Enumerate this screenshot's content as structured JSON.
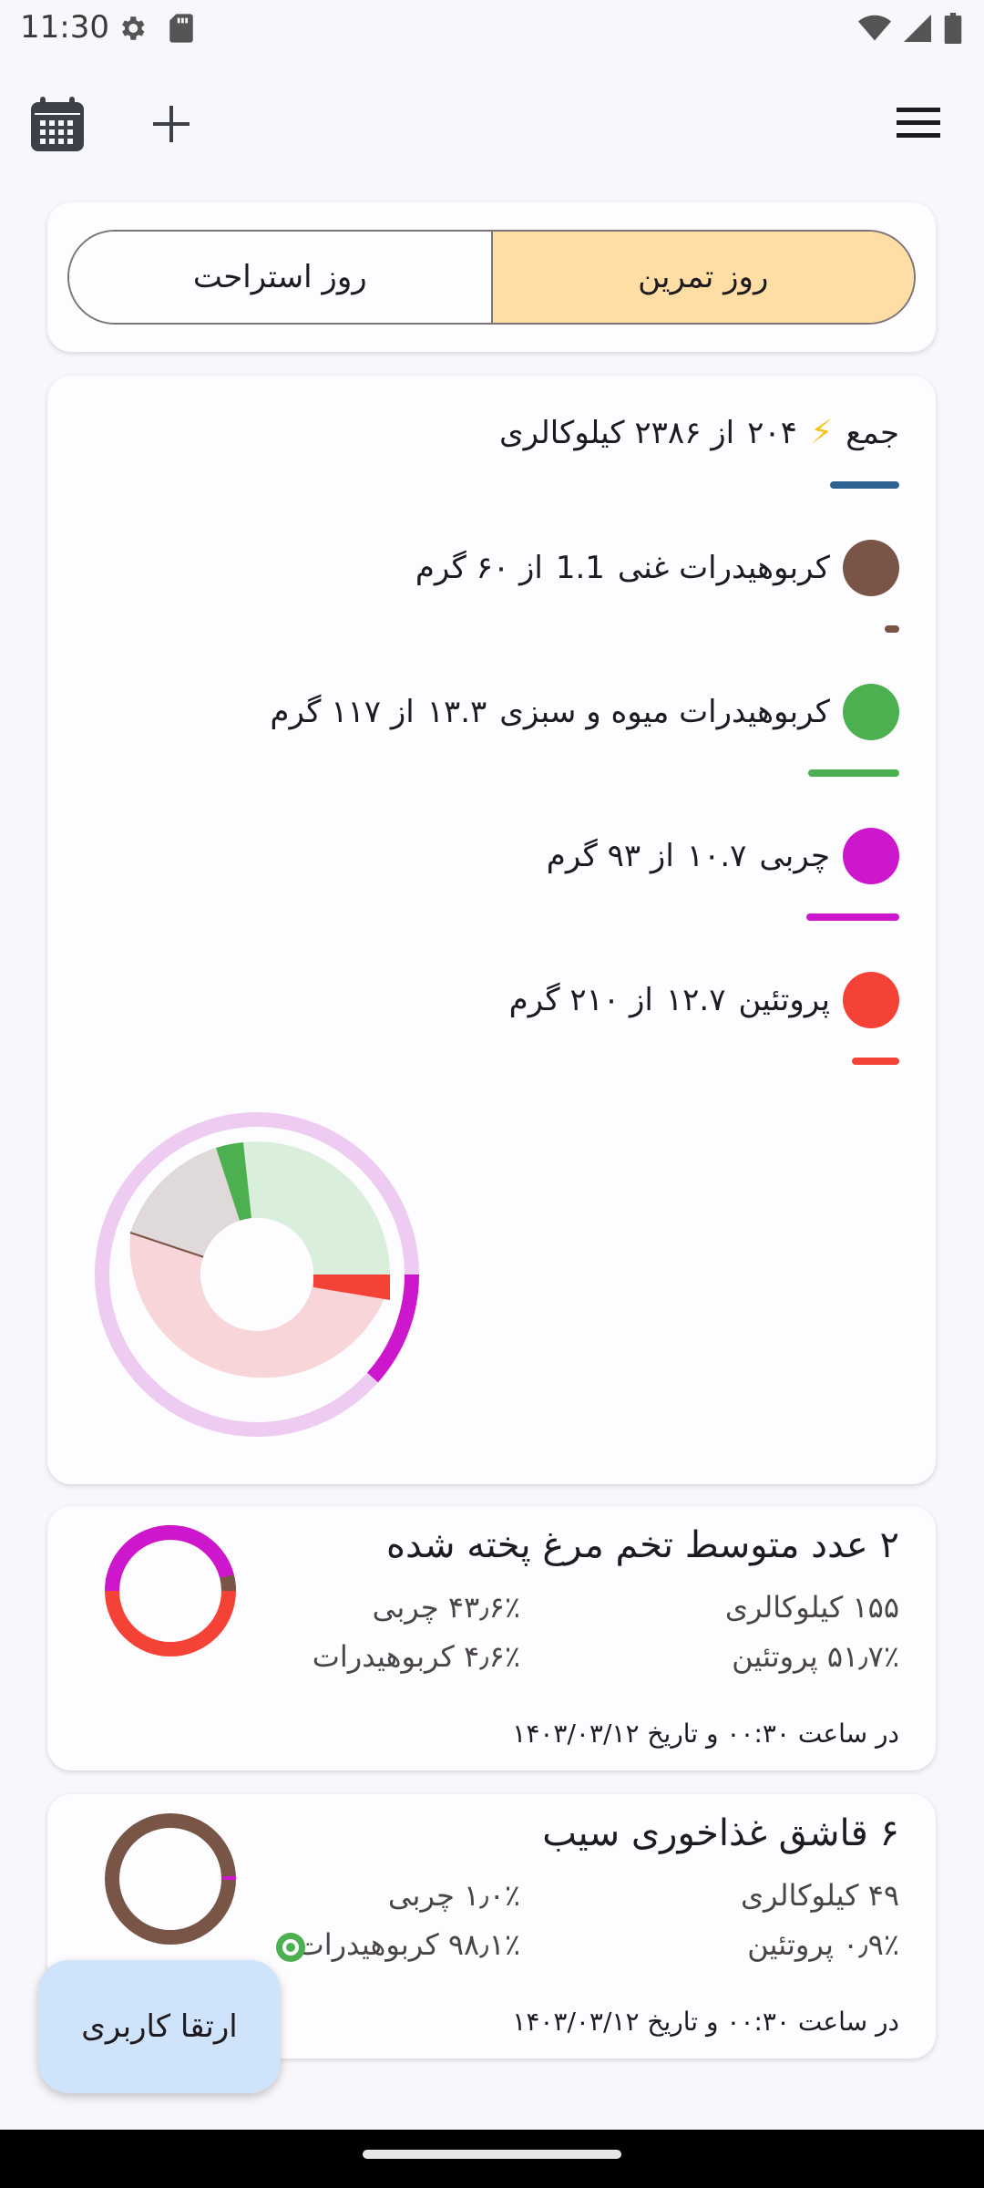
{
  "status_bar": {
    "time": "11:30",
    "icons": [
      "gear-icon",
      "sd-card-icon",
      "wifi-icon",
      "signal-icon",
      "battery-icon"
    ]
  },
  "app_bar": {
    "icons": [
      "calendar-icon",
      "plus-icon",
      "menu-icon"
    ]
  },
  "day_toggle": {
    "options": [
      "روز تمرین",
      "روز استراحت"
    ],
    "selected": "روز تمرین",
    "selected_color": "#ffdea6"
  },
  "summary": {
    "total": {
      "label": "جمع",
      "icon": "lightning-icon",
      "value": "۲۰۴",
      "text": "از ۲۳۸۶ کیلوکالری",
      "color": "#2e6391",
      "progress": 0.086
    },
    "macros": [
      {
        "label": "کربوهیدرات غنی",
        "value": "1.1",
        "text": "از ۶۰ گرم",
        "color": "#795548",
        "progress": 0.02
      },
      {
        "label": "کربوهیدرات میوه و سبزی",
        "value": "۱۳.۳",
        "text": "از ۱۱۷ گرم",
        "color": "#4caf50",
        "progress": 0.11
      },
      {
        "label": "چربی",
        "value": "۱۰.۷",
        "text": "از ۹۳ گرم",
        "color": "#cc17cc",
        "progress": 0.12
      },
      {
        "label": "پروتئین",
        "value": "۱۲.۷",
        "text": "از ۲۱۰ گرم",
        "color": "#f44336",
        "progress": 0.06
      }
    ]
  },
  "foods": [
    {
      "title": "۲ عدد متوسط تخم مرغ پخته شده",
      "calories": "۱۵۵ کیلوکالری",
      "fat": "۴۳٫۶٪ چربی",
      "protein": "۵۱٫۷٪ پروتئین",
      "carbs": "۴٫۶٪ کربوهیدرات",
      "date": "در ساعت ۰۰:۳۰ و تاریخ ۱۴۰۳/۰۳/۱۲",
      "ring": [
        {
          "color": "#f44336",
          "value": 51.7
        },
        {
          "color": "#795548",
          "value": 4.6
        },
        {
          "color": "#cc17cc",
          "value": 43.6
        }
      ],
      "badge": ""
    },
    {
      "title": "۶ قاشق غذاخوری سیب",
      "calories": "۴۹ کیلوکالری",
      "fat": "۱٫۰٪ چربی",
      "protein": "۰٫۹٪ پروتئین",
      "carbs": "۹۸٫۱٪ کربوهیدرات",
      "date": "در ساعت ۰۰:۳۰ و تاریخ ۱۴۰۳/۰۳/۱۲",
      "ring": [
        {
          "color": "#795548",
          "value": 98.1
        },
        {
          "color": "#cc17cc",
          "value": 1.0
        },
        {
          "color": "#f44336",
          "value": 0.9
        }
      ],
      "badge": "leaf-badge-icon"
    }
  ],
  "fab": {
    "label": "ارتقا کاربری"
  }
}
